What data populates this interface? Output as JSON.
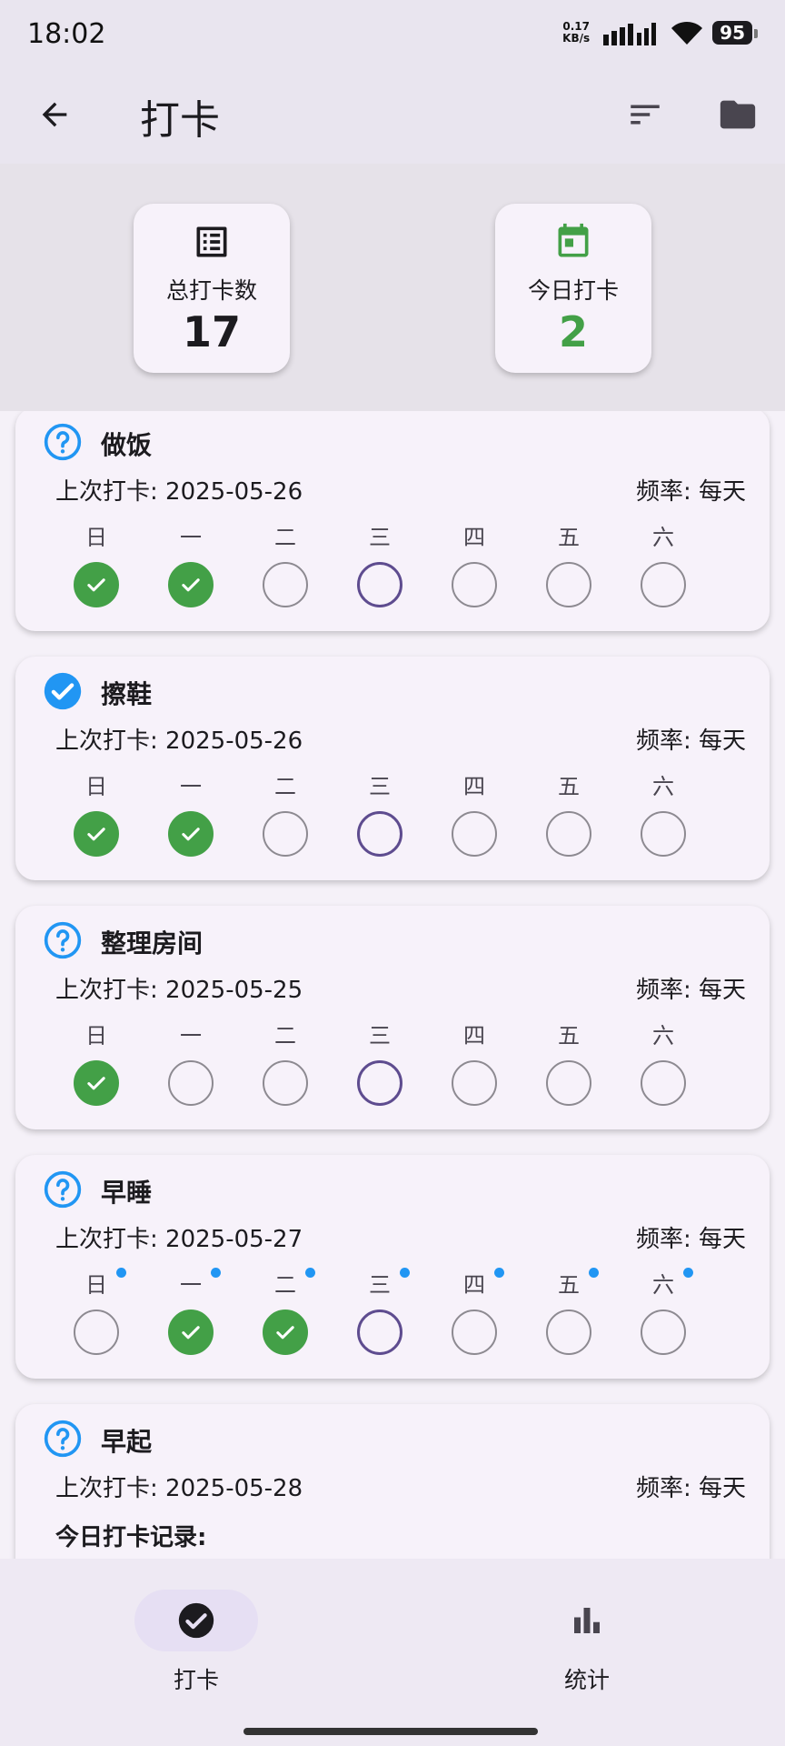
{
  "status_bar": {
    "time": "18:02",
    "net_speed_value": "0.17",
    "net_speed_unit": "KB/s",
    "battery": "95"
  },
  "app_bar": {
    "title": "打卡",
    "back_icon": "arrow-left-icon",
    "sort_icon": "sort-icon",
    "folder_icon": "folder-icon"
  },
  "stats": {
    "total": {
      "label": "总打卡数",
      "value": "17",
      "icon": "list-icon"
    },
    "today": {
      "label": "今日打卡",
      "value": "2",
      "icon": "calendar-icon",
      "color": "#43a047"
    }
  },
  "weekdays": [
    "日",
    "一",
    "二",
    "三",
    "四",
    "五",
    "六"
  ],
  "habits": [
    {
      "name": "做饭",
      "status": "unchecked",
      "last_check": "上次打卡: 2025-05-26",
      "frequency": "频率: 每天",
      "days": [
        "done",
        "done",
        "empty",
        "today",
        "empty",
        "empty",
        "empty"
      ],
      "dots": false
    },
    {
      "name": "擦鞋",
      "status": "checked",
      "last_check": "上次打卡: 2025-05-26",
      "frequency": "频率: 每天",
      "days": [
        "done",
        "done",
        "empty",
        "today",
        "empty",
        "empty",
        "empty"
      ],
      "dots": false
    },
    {
      "name": "整理房间",
      "status": "unchecked",
      "last_check": "上次打卡: 2025-05-25",
      "frequency": "频率: 每天",
      "days": [
        "done",
        "empty",
        "empty",
        "today",
        "empty",
        "empty",
        "empty"
      ],
      "dots": false
    },
    {
      "name": "早睡",
      "status": "unchecked",
      "last_check": "上次打卡: 2025-05-27",
      "frequency": "频率: 每天",
      "days": [
        "empty",
        "done",
        "done",
        "today",
        "empty",
        "empty",
        "empty"
      ],
      "dots": true
    },
    {
      "name": "早起",
      "status": "unchecked",
      "last_check": "上次打卡: 2025-05-28",
      "frequency": "频率: 每天",
      "today_record": "今日打卡记录:"
    }
  ],
  "bottom_nav": [
    {
      "label": "打卡",
      "icon": "check-circle-icon",
      "selected": true
    },
    {
      "label": "统计",
      "icon": "bar-chart-icon",
      "selected": false
    }
  ],
  "colors": {
    "done": "#43a047",
    "today_ring": "#5e4c8f",
    "accent_blue": "#2196f3"
  }
}
